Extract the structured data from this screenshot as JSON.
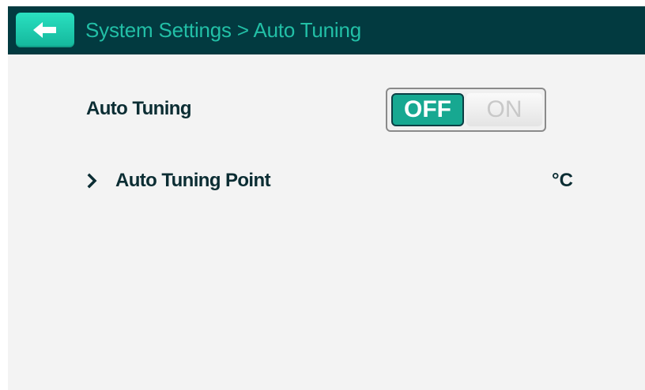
{
  "header": {
    "breadcrumb": "System Settings > Auto Tuning",
    "back_icon": "arrow-left-icon"
  },
  "settings": {
    "auto_tuning": {
      "label": "Auto Tuning",
      "toggle": {
        "off_label": "OFF",
        "on_label": "ON",
        "selected": "OFF"
      }
    },
    "auto_tuning_point": {
      "chevron_icon": "chevron-right-icon",
      "label": "Auto Tuning Point",
      "value": "",
      "unit": "°C"
    }
  },
  "colors": {
    "header_bg": "#023a40",
    "accent": "#17a891",
    "breadcrumb_text": "#22bfa6",
    "body_bg": "#f3f3f3"
  }
}
